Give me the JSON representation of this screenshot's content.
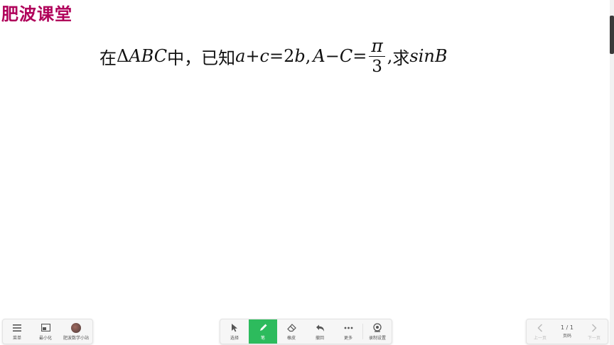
{
  "watermark": "肥波课堂",
  "problem": {
    "prefix": "在",
    "delta": "Δ",
    "triangle": "ABC",
    "middle": "中，已知",
    "a": "a",
    "plus": "+",
    "c": "c",
    "eq": "=",
    "two": "2",
    "b": "b",
    "comma1": ",",
    "A": "A",
    "minus": "−",
    "C": "C",
    "eq2": "=",
    "numerator": "π",
    "denominator": "3",
    "comma2": ",",
    "ask": "求",
    "target": "sinB"
  },
  "toolbar_left": [
    {
      "label": "菜单",
      "icon": "menu-icon"
    },
    {
      "label": "最小化",
      "icon": "minimize-icon"
    },
    {
      "label": "肥波数学小站",
      "icon": "avatar"
    }
  ],
  "toolbar_mid": [
    {
      "label": "选择",
      "icon": "cursor-icon"
    },
    {
      "label": "笔",
      "icon": "pen-icon"
    },
    {
      "label": "橡皮",
      "icon": "eraser-icon"
    },
    {
      "label": "撤回",
      "icon": "undo-icon"
    },
    {
      "label": "更多",
      "icon": "more-icon"
    },
    {
      "label": "录制设置",
      "icon": "record-settings-icon"
    }
  ],
  "toolbar_right": {
    "prev_label": "上一页",
    "page_indicator": "1 / 1",
    "page_label": "页码",
    "next_label": "下一页"
  },
  "colors": {
    "watermark": "#b0005a",
    "active_tool": "#2dbb5d"
  }
}
